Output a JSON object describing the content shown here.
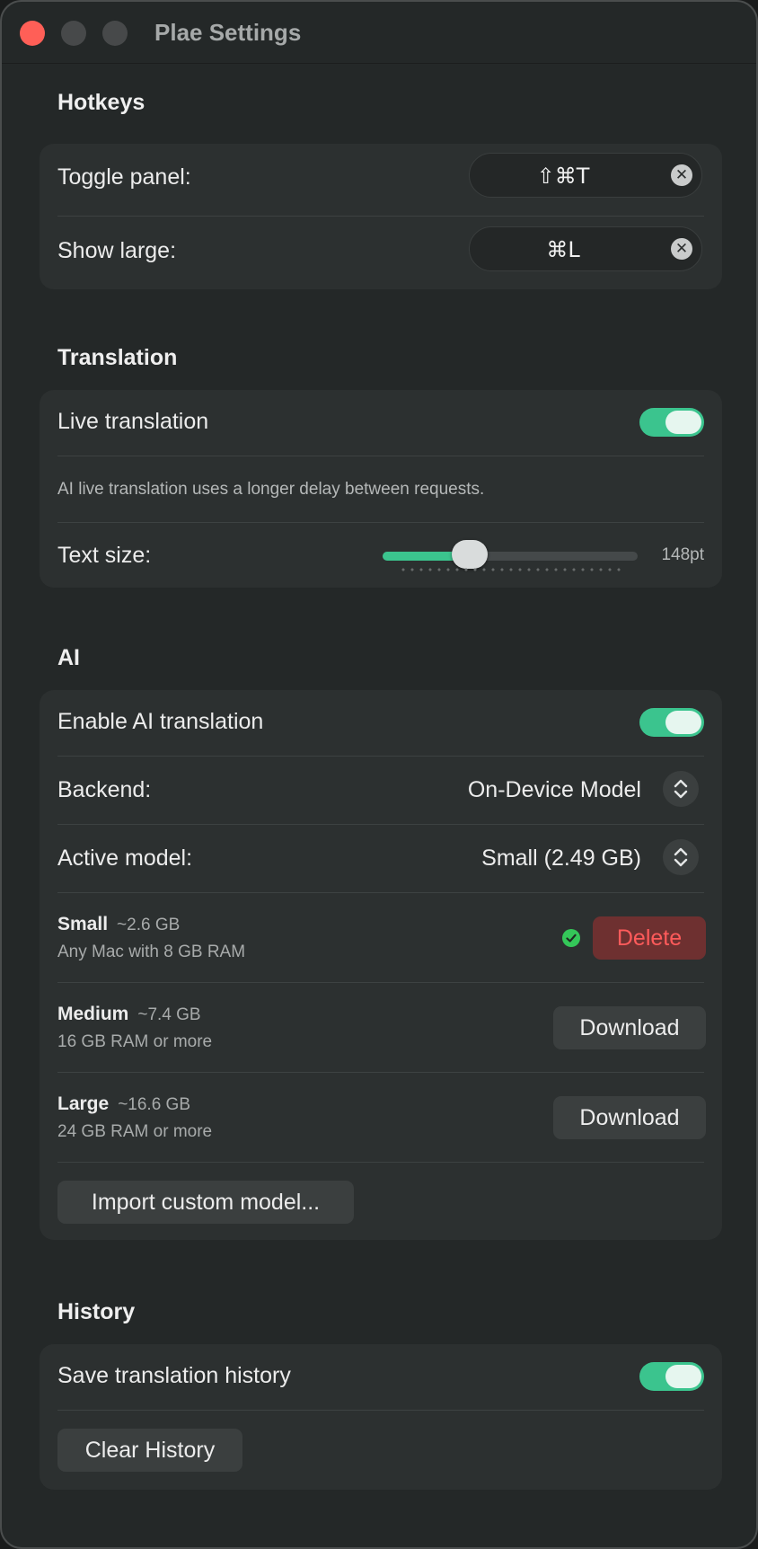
{
  "window": {
    "title": "Plae Settings"
  },
  "colors": {
    "accent": "#3bc48e",
    "success": "#34c759",
    "danger": "#ff5b5b",
    "close": "#ff5f57"
  },
  "hotkeys": {
    "title": "Hotkeys",
    "toggle_panel": {
      "label": "Toggle panel:",
      "shortcut": "⇧⌘T"
    },
    "show_large": {
      "label": "Show large:",
      "shortcut": "⌘L"
    }
  },
  "translation": {
    "title": "Translation",
    "live_translation": {
      "label": "Live translation",
      "enabled": true
    },
    "note": "AI live translation uses a longer delay between requests.",
    "text_size": {
      "label": "Text size:",
      "value_text": "148pt",
      "fraction": 0.34
    }
  },
  "ai": {
    "title": "AI",
    "enable": {
      "label": "Enable AI translation",
      "enabled": true
    },
    "backend": {
      "label": "Backend:",
      "value": "On-Device Model"
    },
    "active_model": {
      "label": "Active model:",
      "value": "Small (2.49 GB)"
    },
    "models": [
      {
        "name": "Small",
        "size": "~2.6 GB",
        "desc": "Any Mac with 8 GB RAM",
        "action": "Delete",
        "installed": true
      },
      {
        "name": "Medium",
        "size": "~7.4 GB",
        "desc": "16 GB RAM or more",
        "action": "Download",
        "installed": false
      },
      {
        "name": "Large",
        "size": "~16.6 GB",
        "desc": "24 GB RAM or more",
        "action": "Download",
        "installed": false
      }
    ],
    "import_label": "Import custom model..."
  },
  "history": {
    "title": "History",
    "save": {
      "label": "Save translation history",
      "enabled": true
    },
    "clear_label": "Clear History"
  }
}
